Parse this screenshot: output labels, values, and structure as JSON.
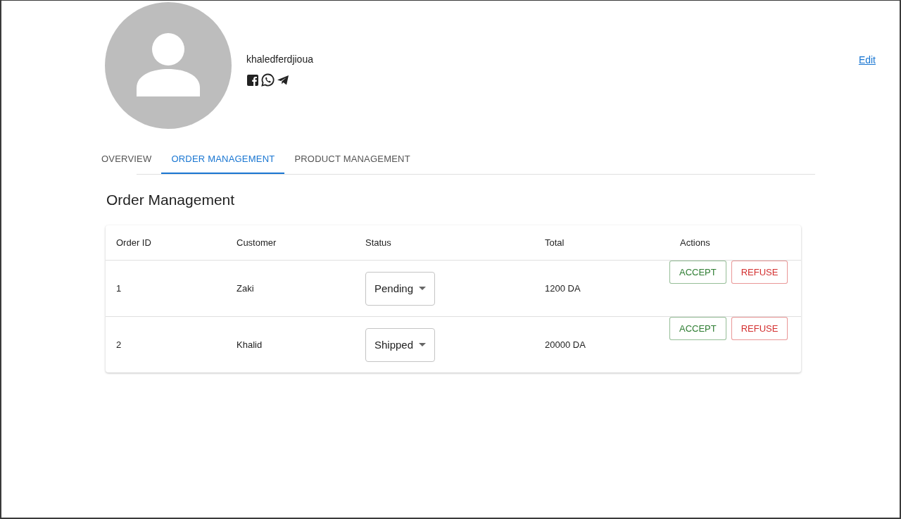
{
  "profile": {
    "username": "khaledferdjioua",
    "edit_link": "Edit"
  },
  "tabs": [
    {
      "label": "OVERVIEW",
      "selected": false
    },
    {
      "label": "ORDER MANAGEMENT",
      "selected": true
    },
    {
      "label": "PRODUCT MANAGEMENT",
      "selected": false
    }
  ],
  "section_title": "Order Management",
  "table": {
    "columns": [
      "Order ID",
      "Customer",
      "Status",
      "Total",
      "Actions"
    ],
    "rows": [
      {
        "order_id": "1",
        "customer": "Zaki",
        "status": "Pending",
        "total": "1200 DA",
        "actions": [
          {
            "label": "ACCEPT",
            "kind": "accept"
          },
          {
            "label": "REFUSE",
            "kind": "refuse"
          }
        ]
      },
      {
        "order_id": "2",
        "customer": "Khalid",
        "status": "Shipped",
        "total": "20000 DA",
        "actions": [
          {
            "label": "ACCEPT",
            "kind": "accept"
          },
          {
            "label": "REFUSE",
            "kind": "refuse"
          }
        ]
      }
    ]
  }
}
